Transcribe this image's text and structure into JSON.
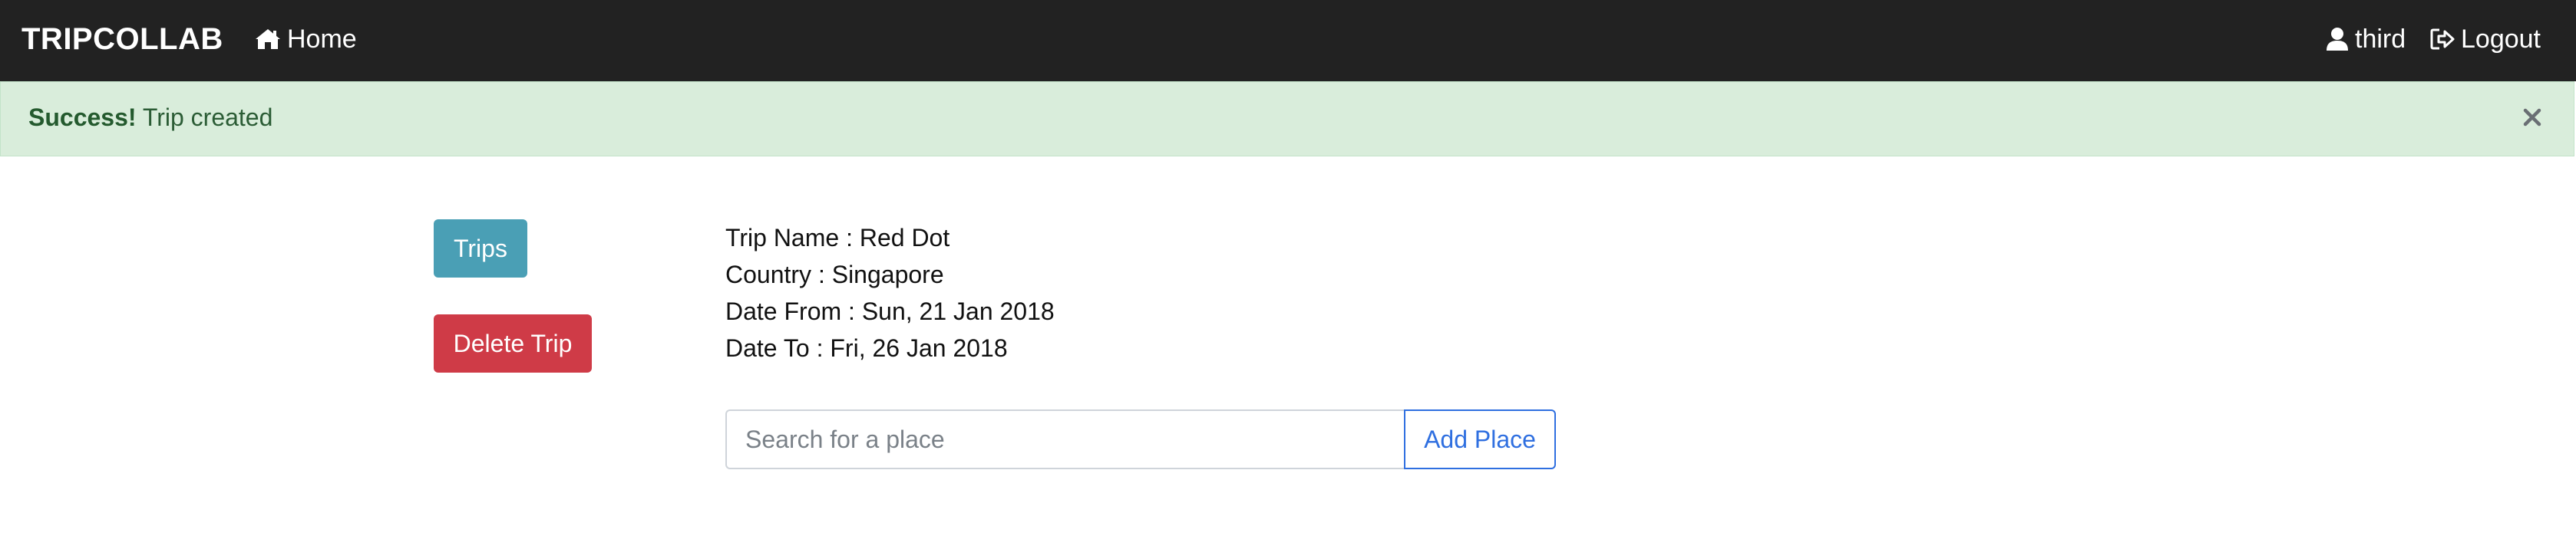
{
  "navbar": {
    "brand": "TRIPCOLLAB",
    "home_label": "Home",
    "user_label": "third",
    "logout_label": "Logout",
    "background_color": "#222222"
  },
  "alert": {
    "strong": "Success!",
    "message": " Trip created",
    "close_icon": "close-icon",
    "background_color": "#d9eddb"
  },
  "sidebar": {
    "trips_label": "Trips",
    "delete_label": "Delete Trip",
    "trips_color": "#4a9fb5",
    "delete_color": "#cf3b47"
  },
  "trip": {
    "name_line": "Trip Name : Red Dot",
    "country_line": "Country : Singapore",
    "from_line": "Date From : Sun, 21 Jan 2018",
    "to_line": "Date To : Fri, 26 Jan 2018"
  },
  "search": {
    "placeholder": "Search for a place",
    "value": "",
    "add_label": "Add Place",
    "accent_color": "#2f6fe0"
  }
}
